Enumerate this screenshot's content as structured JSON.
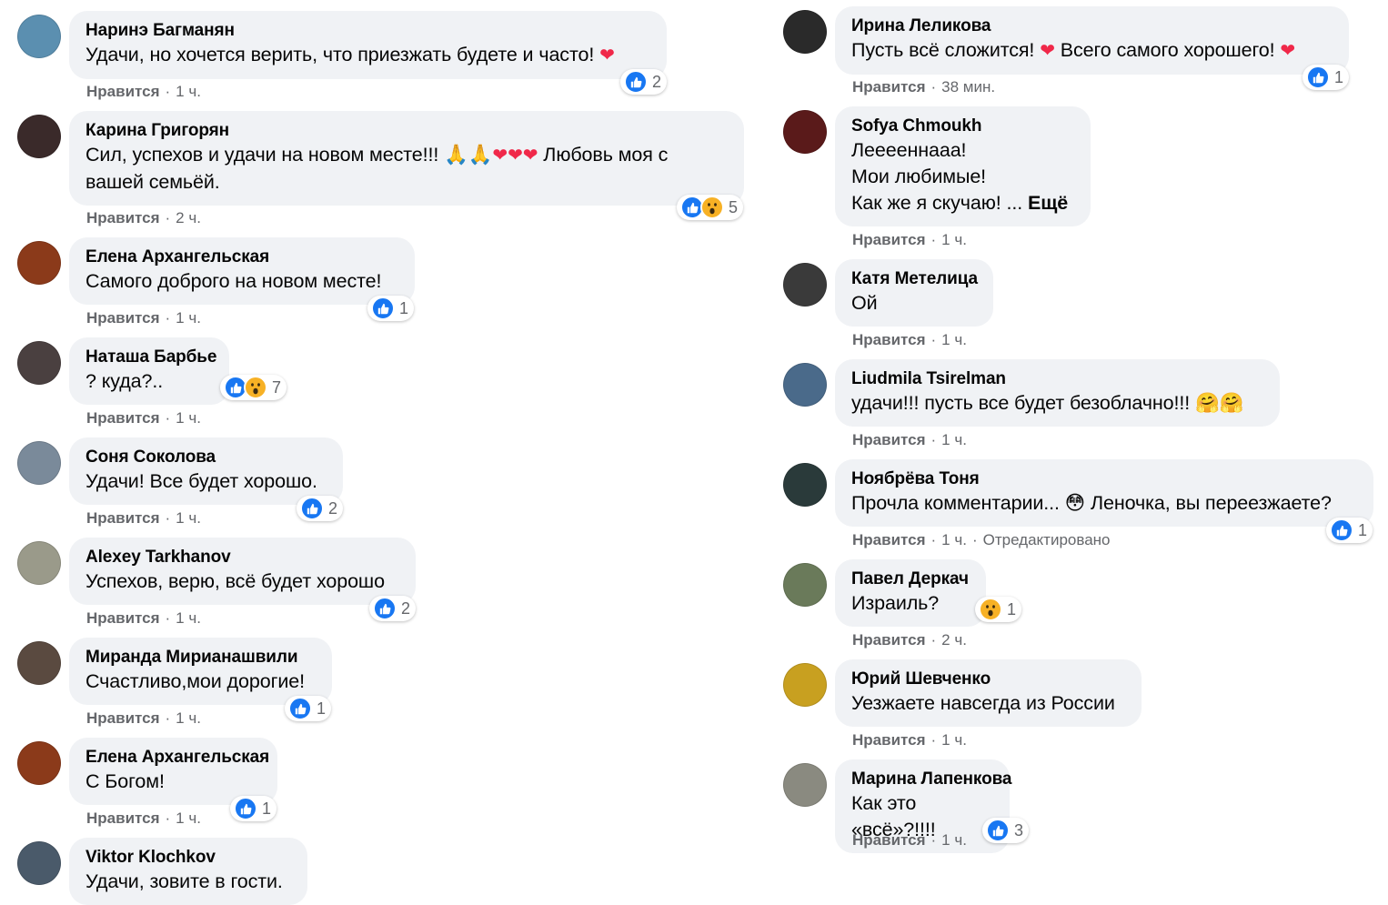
{
  "left_comments": [
    {
      "author": "Наринэ Багманян",
      "text": "Удачи, но хочется верить, что приезжать будете и часто! ❤️",
      "reaction_count": "2",
      "reactions": [
        "like-icon"
      ],
      "like_label": "Нравится",
      "time": "1 ч."
    },
    {
      "author": "Карина Григорян",
      "text": "Сил, успехов и удачи на новом месте!!! 🙏🙏❤️❤️❤️ Любовь моя с\nвашей семьёй.",
      "reaction_count": "5",
      "reactions": [
        "like-icon",
        "wow-icon"
      ],
      "like_label": "Нравится",
      "time": "2 ч."
    },
    {
      "author": "Елена Архангельская",
      "text": "Самого доброго на новом месте!",
      "reaction_count": "1",
      "reactions": [
        "like-icon"
      ],
      "like_label": "Нравится",
      "time": "1 ч."
    },
    {
      "author": "Наташа Барбье",
      "text": "? куда?..",
      "reaction_count": "7",
      "reactions": [
        "like-icon",
        "wow-icon"
      ],
      "like_label": "Нравится",
      "time": "1 ч."
    },
    {
      "author": "Соня Соколова",
      "text": "Удачи! Все будет хорошо.",
      "reaction_count": "2",
      "reactions": [
        "like-icon"
      ],
      "like_label": "Нравится",
      "time": "1 ч."
    },
    {
      "author": "Alexey Tarkhanov",
      "text": "Успехов, верю, всё будет хорошо",
      "reaction_count": "2",
      "reactions": [
        "like-icon"
      ],
      "like_label": "Нравится",
      "time": "1 ч."
    },
    {
      "author": "Миранда Мирианашвили",
      "text": "Счастливо,мои дорогие!",
      "reaction_count": "1",
      "reactions": [
        "like-icon"
      ],
      "like_label": "Нравится",
      "time": "1 ч."
    },
    {
      "author": "Елена Архангельская",
      "text": "С Богом!",
      "reaction_count": "1",
      "reactions": [
        "like-icon"
      ],
      "like_label": "Нравится",
      "time": "1 ч."
    },
    {
      "author": "Viktor Klochkov",
      "text": "Удачи, зовите в гости.",
      "reaction_count": "",
      "reactions": [],
      "like_label": "",
      "time": ""
    }
  ],
  "right_comments": [
    {
      "author": "Ирина Леликова",
      "text": "Пусть всё сложится! ❤️ Всего самого хорошего! ❤️",
      "reaction_count": "1",
      "reactions": [
        "like-icon"
      ],
      "like_label": "Нравится",
      "time": "38 мин."
    },
    {
      "author": "Sofya Chmoukh",
      "text": "Лееееннааа!\nМои любимые!\nКак же я скучаю! ... ",
      "more": "Ещё",
      "reaction_count": "",
      "reactions": [],
      "like_label": "Нравится",
      "time": "1 ч."
    },
    {
      "author": "Катя Метелица",
      "text": "Ой",
      "reaction_count": "",
      "reactions": [],
      "like_label": "Нравится",
      "time": "1 ч."
    },
    {
      "author": "Liudmila Tsirelman",
      "text": "удачи!!! пусть все будет безоблачно!!! 🤗🤗",
      "reaction_count": "",
      "reactions": [],
      "like_label": "Нравится",
      "time": "1 ч."
    },
    {
      "author": "Ноябрёва Тоня",
      "text": "Прочла комментарии... 😳 Леночка, вы переезжаете?",
      "reaction_count": "1",
      "reactions": [
        "like-icon"
      ],
      "like_label": "Нравится",
      "time": "1 ч.",
      "edited": "Отредактировано"
    },
    {
      "author": "Павел Деркач",
      "text": "Израиль?",
      "reaction_count": "1",
      "reactions": [
        "wow-icon"
      ],
      "like_label": "Нравится",
      "time": "2 ч."
    },
    {
      "author": "Юрий Шевченко",
      "text": "Уезжаете навсегда из России",
      "reaction_count": "",
      "reactions": [],
      "like_label": "Нравится",
      "time": "1 ч."
    },
    {
      "author": "Марина Лапенкова",
      "text": "Как это «всё»?!!!!",
      "reaction_count": "3",
      "reactions": [
        "like-icon"
      ],
      "like_label": "Нравится",
      "time": "1 ч."
    }
  ],
  "colors": {
    "bubble": "#f0f2f5",
    "meta": "#65676b",
    "like": "#1877f2",
    "wow": "#f7b125",
    "heart": "#f02849"
  }
}
